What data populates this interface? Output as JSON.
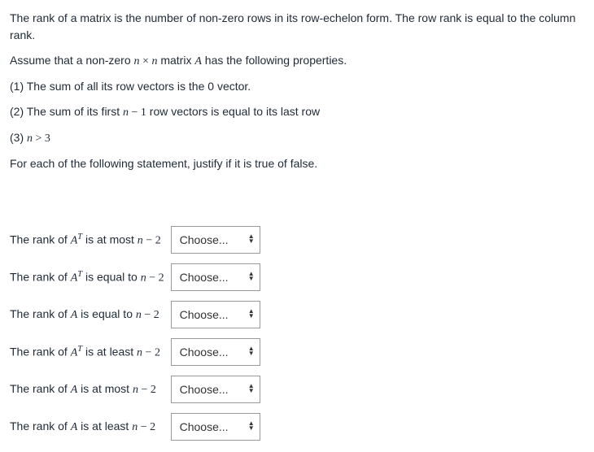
{
  "intro": {
    "p1": "The rank of a matrix is the number of non-zero rows in its row-echelon form. The row rank is equal to the column rank.",
    "p2_pre": "Assume that a non-zero ",
    "p2_mid": " matrix ",
    "p2_post": " has the following properties.",
    "nxn_left": "n",
    "nxn_times": " × ",
    "nxn_right": "n",
    "A": "A",
    "prop1": "(1) The sum of all its row vectors  is the 0 vector.",
    "prop2_pre": "(2) The sum of its first ",
    "prop2_expr_n": "n",
    "prop2_expr_minus": " − ",
    "prop2_expr_one": "1",
    "prop2_post": " row vectors is equal to its last row",
    "prop3_pre": "(3) ",
    "prop3_n": "n",
    "prop3_gt": " > ",
    "prop3_three": "3",
    "instr": "For each of the following statement, justify if it is true of false."
  },
  "labels": {
    "rank_of": "The rank of ",
    "A": "A",
    "T": "T",
    "is_at_most": " is at most ",
    "is_equal_to": " is equal to ",
    "is_at_least": " is at least ",
    "n": "n",
    "minus": " − ",
    "two": "2",
    "also": " "
  },
  "dropdown": {
    "placeholder": "Choose..."
  },
  "statements": [
    {
      "target": "AT",
      "rel": "at_most"
    },
    {
      "target": "AT",
      "rel": "equal"
    },
    {
      "target": "A",
      "rel": "equal_sp"
    },
    {
      "target": "AT",
      "rel": "at_least"
    },
    {
      "target": "A",
      "rel": "at_most"
    },
    {
      "target": "A",
      "rel": "at_least"
    }
  ]
}
